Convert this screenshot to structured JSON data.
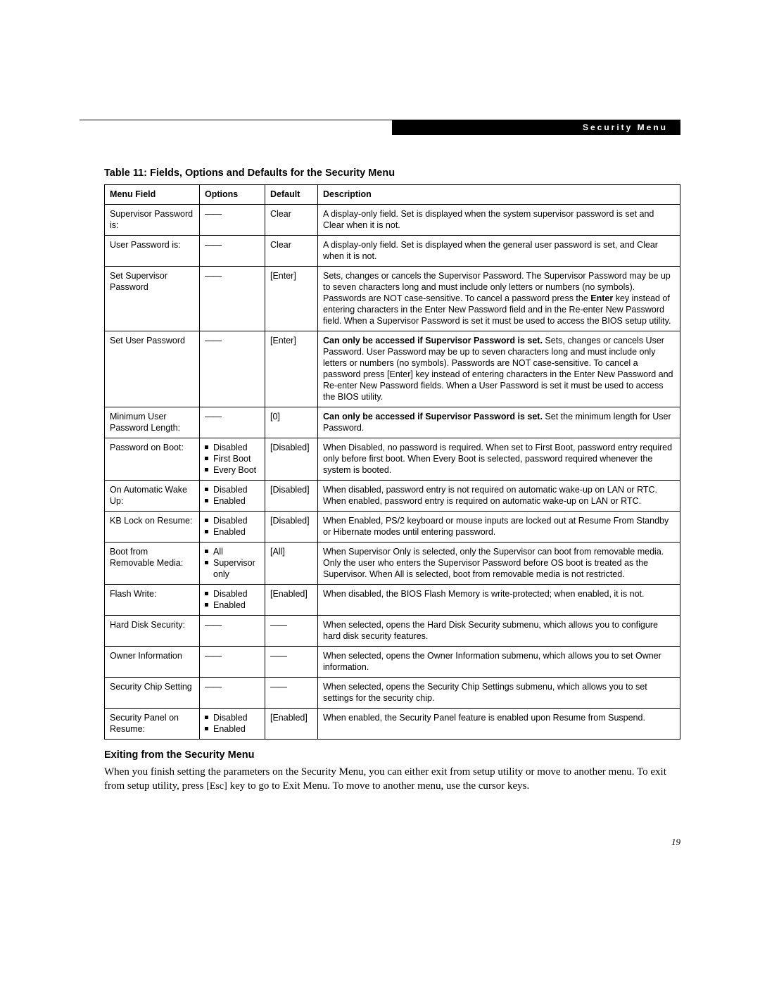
{
  "header": {
    "tab_label": "Security Menu"
  },
  "table": {
    "title": "Table 11: Fields, Options and Defaults for the Security Menu",
    "columns": {
      "c1": "Menu Field",
      "c2": "Options",
      "c3": "Default",
      "c4": "Description"
    },
    "dash": "——",
    "rows": {
      "r0": {
        "field": "Supervisor Password is:",
        "default": "Clear",
        "desc": "A display-only field. Set is displayed when the system supervisor password is set and Clear when it is not."
      },
      "r1": {
        "field": "User Password is:",
        "default": "Clear",
        "desc": "A display-only field. Set is displayed when the general user password is set, and Clear when it is not."
      },
      "r2": {
        "field": "Set Supervisor Password",
        "default": "[Enter]",
        "desc_a": "Sets, changes or cancels the Supervisor Password. The Supervisor Password may be up to seven characters long and must include only letters or numbers (no symbols). Passwords are NOT case-sensitive. To cancel a password press the ",
        "desc_bold": "Enter",
        "desc_b": " key instead of entering characters in the Enter New Password field and in the Re-enter New Password field. When a Supervisor Password is set it must be used to access the BIOS setup utility."
      },
      "r3": {
        "field": "Set User Password",
        "default": "[Enter]",
        "desc_bold": "Can only be accessed if Supervisor Password is set.",
        "desc_a": " Sets, changes or cancels User Password. User Password may be up to seven characters long and must include only letters or numbers (no symbols). Passwords are NOT case-sensitive. To cancel a password press ",
        "desc_key": "[Enter]",
        "desc_b": " key instead of entering characters in the Enter New Password and Re-enter New Password fields. When a User Password is set it must be used to access the BIOS utility."
      },
      "r4": {
        "field": "Minimum User Password Length:",
        "default": "[0]",
        "desc_bold": "Can only be accessed if Supervisor Password is set.",
        "desc": " Set the minimum length for User Password."
      },
      "r5": {
        "field": "Password on Boot:",
        "opt0": "Disabled",
        "opt1": "First Boot",
        "opt2": "Every Boot",
        "default": "[Disabled]",
        "desc": "When Disabled, no password is required. When set to First Boot, password entry required only before first boot. When Every Boot is selected, password required whenever the system is booted."
      },
      "r6": {
        "field": "On Automatic Wake Up:",
        "opt0": "Disabled",
        "opt1": "Enabled",
        "default": "[Disabled]",
        "desc": "When disabled, password entry is not required on automatic wake-up on LAN or RTC. When enabled, password entry is required on automatic wake-up on LAN or RTC."
      },
      "r7": {
        "field": "KB Lock on Resume:",
        "opt0": "Disabled",
        "opt1": "Enabled",
        "default": "[Disabled]",
        "desc": "When Enabled, PS/2 keyboard or mouse inputs are locked out at Resume From Standby or Hibernate modes until entering password."
      },
      "r8": {
        "field": "Boot from Removable Media:",
        "opt0": "All",
        "opt1": "Supervisor only",
        "default": "[All]",
        "desc": "When Supervisor Only is selected, only the Supervisor can boot from removable media. Only the user who enters the Supervisor Password before OS boot is treated as the Supervisor. When All is selected, boot from removable media is not restricted."
      },
      "r9": {
        "field": "Flash Write:",
        "opt0": "Disabled",
        "opt1": "Enabled",
        "default": "[Enabled]",
        "desc": "When disabled, the BIOS Flash Memory is write-protected; when enabled, it is not."
      },
      "r10": {
        "field": "Hard Disk Security:",
        "desc": "When selected, opens the Hard Disk Security submenu, which allows you to configure hard disk security features."
      },
      "r11": {
        "field": "Owner Information",
        "desc": "When selected, opens the Owner Information submenu, which allows you to set Owner information."
      },
      "r12": {
        "field": "Security Chip Setting",
        "desc": "When selected, opens the Security Chip Settings submenu, which allows you to set settings for the security chip."
      },
      "r13": {
        "field": "Security Panel on Resume:",
        "opt0": "Disabled",
        "opt1": "Enabled",
        "default": "[Enabled]",
        "desc": "When enabled, the Security Panel feature is enabled upon Resume from Suspend."
      }
    }
  },
  "exit_section": {
    "title": "Exiting from the Security Menu",
    "body_a": "When you finish setting the parameters on the Security Menu, you can either exit from setup utility or move to another menu. To exit from setup utility, press ",
    "key": "[Esc]",
    "body_b": " key to go to Exit Menu. To move to another menu, use the cursor keys."
  },
  "page_number": "19"
}
